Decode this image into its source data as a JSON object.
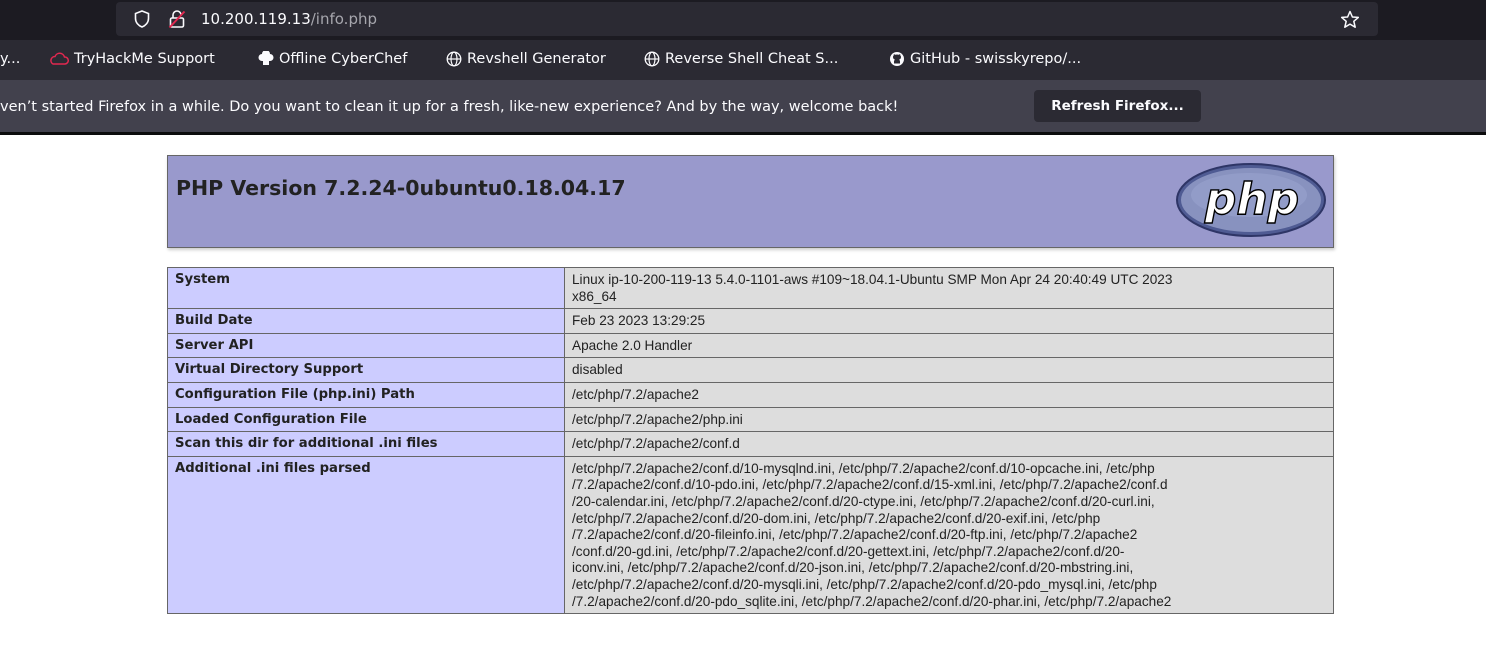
{
  "browser": {
    "url_host": "10.200.119.13",
    "url_path": "/info.php",
    "bookmarks": [
      {
        "label": "y...",
        "icon": "folder-icon"
      },
      {
        "label": "TryHackMe Support",
        "icon": "tryhackme-icon"
      },
      {
        "label": "Offline CyberChef",
        "icon": "chef-hat-icon"
      },
      {
        "label": "Revshell Generator",
        "icon": "globe-icon"
      },
      {
        "label": "Reverse Shell Cheat S...",
        "icon": "globe-icon"
      },
      {
        "label": "GitHub - swisskyrepo/...",
        "icon": "github-icon"
      }
    ],
    "notification": {
      "message": "ven’t started Firefox in a while. Do you want to clean it up for a fresh, like-new experience? And by the way, welcome back!",
      "button": "Refresh Firefox..."
    }
  },
  "php": {
    "title": "PHP Version 7.2.24-0ubuntu0.18.04.17",
    "logo_text": "php",
    "rows": [
      {
        "key": "System",
        "lines": [
          "Linux ip-10-200-119-13 5.4.0-1101-aws #109~18.04.1-Ubuntu SMP Mon Apr 24 20:40:49 UTC 2023",
          "x86_64"
        ]
      },
      {
        "key": "Build Date",
        "lines": [
          "Feb 23 2023 13:29:25"
        ]
      },
      {
        "key": "Server API",
        "lines": [
          "Apache 2.0 Handler"
        ]
      },
      {
        "key": "Virtual Directory Support",
        "lines": [
          "disabled"
        ]
      },
      {
        "key": "Configuration File (php.ini) Path",
        "lines": [
          "/etc/php/7.2/apache2"
        ]
      },
      {
        "key": "Loaded Configuration File",
        "lines": [
          "/etc/php/7.2/apache2/php.ini"
        ]
      },
      {
        "key": "Scan this dir for additional .ini files",
        "lines": [
          "/etc/php/7.2/apache2/conf.d"
        ]
      },
      {
        "key": "Additional .ini files parsed",
        "lines": [
          "/etc/php/7.2/apache2/conf.d/10-mysqlnd.ini, /etc/php/7.2/apache2/conf.d/10-opcache.ini, /etc/php",
          "/7.2/apache2/conf.d/10-pdo.ini, /etc/php/7.2/apache2/conf.d/15-xml.ini, /etc/php/7.2/apache2/conf.d",
          "/20-calendar.ini, /etc/php/7.2/apache2/conf.d/20-ctype.ini, /etc/php/7.2/apache2/conf.d/20-curl.ini,",
          "/etc/php/7.2/apache2/conf.d/20-dom.ini, /etc/php/7.2/apache2/conf.d/20-exif.ini, /etc/php",
          "/7.2/apache2/conf.d/20-fileinfo.ini, /etc/php/7.2/apache2/conf.d/20-ftp.ini, /etc/php/7.2/apache2",
          "/conf.d/20-gd.ini, /etc/php/7.2/apache2/conf.d/20-gettext.ini, /etc/php/7.2/apache2/conf.d/20-",
          "iconv.ini, /etc/php/7.2/apache2/conf.d/20-json.ini, /etc/php/7.2/apache2/conf.d/20-mbstring.ini,",
          "/etc/php/7.2/apache2/conf.d/20-mysqli.ini, /etc/php/7.2/apache2/conf.d/20-pdo_mysql.ini, /etc/php",
          "/7.2/apache2/conf.d/20-pdo_sqlite.ini, /etc/php/7.2/apache2/conf.d/20-phar.ini, /etc/php/7.2/apache2"
        ]
      }
    ]
  },
  "colors": {
    "chrome_dark": "#1c1b22",
    "chrome": "#2b2a33",
    "notification": "#42414d",
    "php_header": "#9999cc",
    "php_key_cell": "#ccccff",
    "php_value_cell": "#dddddd"
  }
}
